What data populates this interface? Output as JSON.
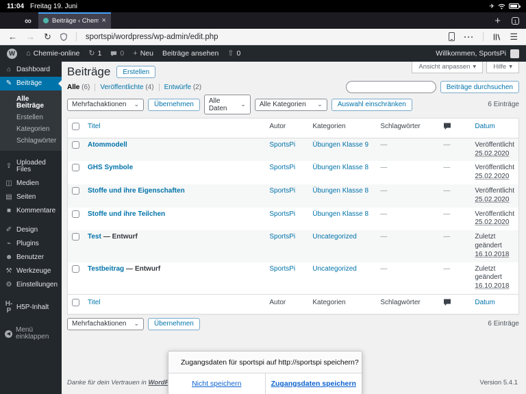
{
  "status_bar": {
    "time": "11:04",
    "date": "Freitag 19. Juni",
    "plane_icon": "✈"
  },
  "tab_bar": {
    "mask_icon": "∞",
    "tab_title": "Beiträge ‹ Chemie-o",
    "close_icon": "×",
    "new_tab_icon": "+",
    "tab_count": "1"
  },
  "toolbar": {
    "back_icon": "←",
    "forward_icon": "→",
    "reload_icon": "↻",
    "url": "sportspi/wordpress/wp-admin/edit.php",
    "more_icon": "···",
    "menu_icon": "☰"
  },
  "admin_bar": {
    "wp_logo": "W",
    "home_icon": "⌂",
    "site_name": "Chemie-online",
    "updates_icon": "↻",
    "updates_count": "1",
    "comments_count": "0",
    "new_icon": "+",
    "new_label": "Neu",
    "view_posts": "Beiträge ansehen",
    "upload_icon": "⇧",
    "upload_count": "0",
    "greeting": "Willkommen, SportsPi"
  },
  "sidebar": {
    "top": [
      {
        "icon": "⌂",
        "label": "Dashboard"
      },
      {
        "icon": "✎",
        "label": "Beiträge",
        "active": true
      }
    ],
    "submenu": [
      {
        "label": "Alle Beiträge",
        "current": true
      },
      {
        "label": "Erstellen"
      },
      {
        "label": "Kategorien"
      },
      {
        "label": "Schlagwörter"
      }
    ],
    "middle": [
      {
        "icon": "⇪",
        "label": "Uploaded Files"
      },
      {
        "icon": "◫",
        "label": "Medien"
      },
      {
        "icon": "▤",
        "label": "Seiten"
      },
      {
        "icon": "■",
        "label": "Kommentare"
      }
    ],
    "lower": [
      {
        "icon": "✐",
        "label": "Design"
      },
      {
        "icon": "⌁",
        "label": "Plugins"
      },
      {
        "icon": "☻",
        "label": "Benutzer"
      },
      {
        "icon": "⚒",
        "label": "Werkzeuge"
      },
      {
        "icon": "⚙",
        "label": "Einstellungen"
      }
    ],
    "h5p": {
      "icon": "H-P",
      "label": "H5P-Inhalt"
    },
    "collapse": {
      "icon": "◀",
      "label": "Menü einklappen"
    }
  },
  "page": {
    "title": "Beiträge",
    "create_button": "Erstellen",
    "screen_options": "Ansicht anpassen",
    "help": "Hilfe",
    "dropdown_arrow": "▾",
    "filters": [
      {
        "label": "Alle",
        "count": "(6)",
        "current": true
      },
      {
        "label": "Veröffentlichte",
        "count": "(4)"
      },
      {
        "label": "Entwürfe",
        "count": "(2)"
      }
    ],
    "search_button": "Beiträge durchsuchen",
    "bulk_action": "Mehrfachaktionen",
    "apply_button": "Übernehmen",
    "date_filter": "Alle Daten",
    "category_filter": "Alle Kategorien",
    "filter_button": "Auswahl einschränken",
    "select_chevron": "⌄",
    "item_count": "6 Einträge",
    "columns": {
      "title": "Titel",
      "author": "Autor",
      "categories": "Kategorien",
      "tags": "Schlagwörter",
      "date": "Datum"
    },
    "rows": [
      {
        "title": "Atommodell",
        "author": "SportsPi",
        "category": "Übungen Klasse 9",
        "tags": "—",
        "comments": "—",
        "date_status": "Veröffentlicht",
        "date": "25.02.2020"
      },
      {
        "title": "GHS Symbole",
        "author": "SportsPi",
        "category": "Übungen Klasse 8",
        "tags": "—",
        "comments": "—",
        "date_status": "Veröffentlicht",
        "date": "25.02.2020"
      },
      {
        "title": "Stoffe und ihre Eigenschaften",
        "author": "SportsPi",
        "category": "Übungen Klasse 8",
        "tags": "—",
        "comments": "—",
        "date_status": "Veröffentlicht",
        "date": "25.02.2020"
      },
      {
        "title": "Stoffe und ihre Teilchen",
        "author": "SportsPi",
        "category": "Übungen Klasse 8",
        "tags": "—",
        "comments": "—",
        "date_status": "Veröffentlicht",
        "date": "25.02.2020"
      },
      {
        "title": "Test",
        "suffix": "— Entwurf",
        "author": "SportsPi",
        "category": "Uncategorized",
        "tags": "—",
        "comments": "—",
        "date_status": "Zuletzt geändert",
        "date": "16.10.2018"
      },
      {
        "title": "Testbeitrag",
        "suffix": "— Entwurf",
        "author": "SportsPi",
        "category": "Uncategorized",
        "tags": "—",
        "comments": "—",
        "date_status": "Zuletzt geändert",
        "date": "16.10.2018"
      }
    ],
    "footer": {
      "thanks_pre": "Danke für dein Vertrauen in",
      "link": "WordPress",
      "thanks_post": ".",
      "version": "Version 5.4.1"
    }
  },
  "doorhanger": {
    "message": "Zugangsdaten für sportspi auf http://sportspi speichern?",
    "decline": "Nicht speichern",
    "accept": "Zugangsdaten speichern"
  }
}
